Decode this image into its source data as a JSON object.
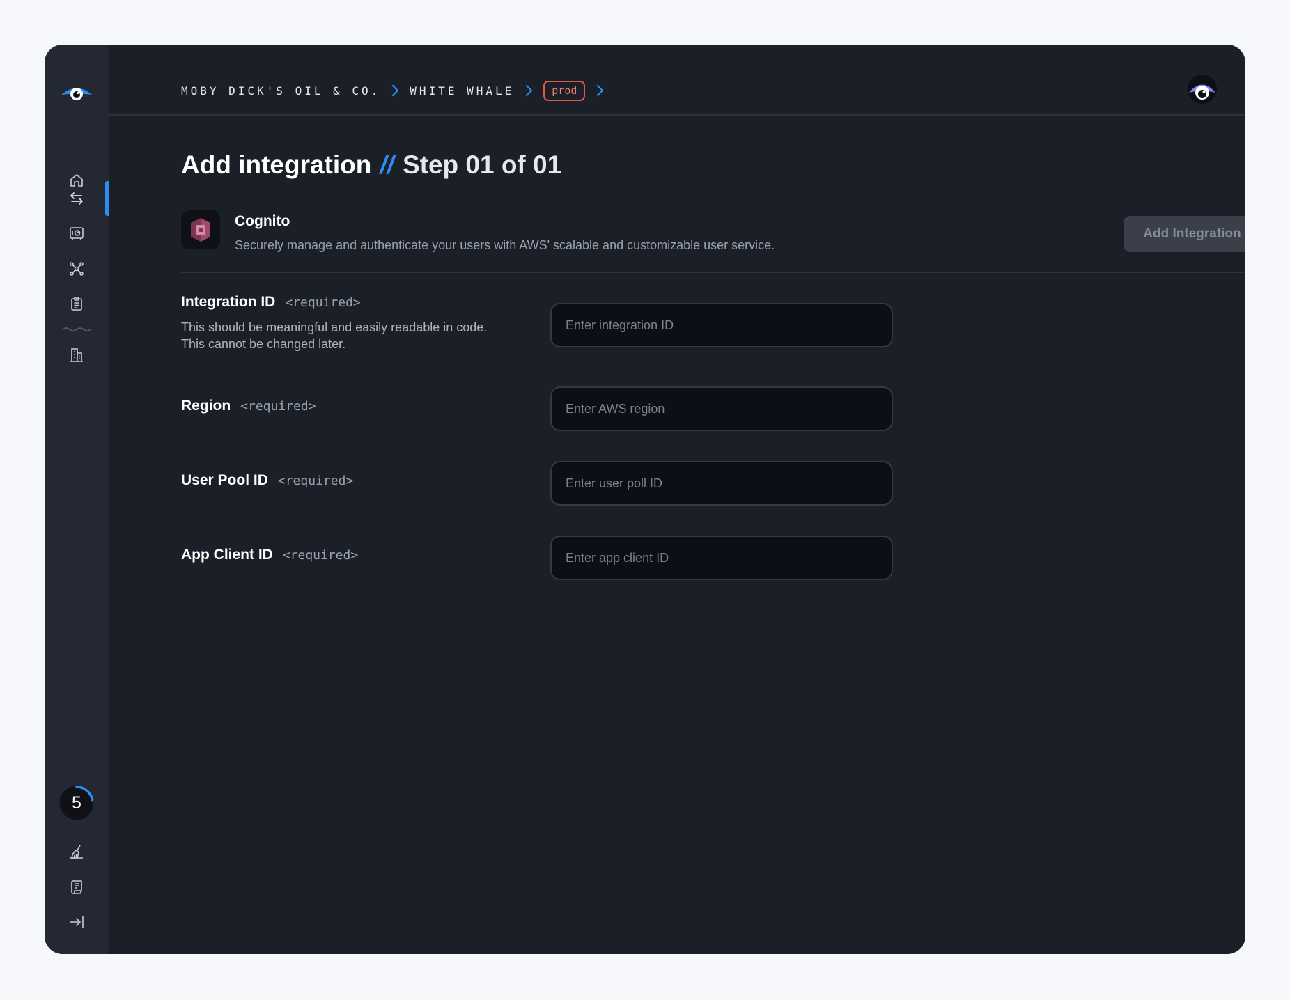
{
  "breadcrumb": {
    "org": "MOBY DICK'S OIL & CO.",
    "project": "WHITE_WHALE",
    "environment": "prod"
  },
  "sidebar": {
    "items": [
      {
        "name": "home",
        "icon": "home-icon"
      },
      {
        "name": "integrations",
        "icon": "swap-arrows-icon",
        "active": true
      },
      {
        "name": "vault",
        "icon": "safe-icon"
      },
      {
        "name": "connections",
        "icon": "network-icon"
      },
      {
        "name": "clipboard",
        "icon": "clipboard-icon"
      },
      {
        "name": "organization",
        "icon": "building-icon"
      }
    ],
    "bottom_items": [
      {
        "name": "clean",
        "icon": "broom-icon"
      },
      {
        "name": "docs",
        "icon": "scroll-icon"
      },
      {
        "name": "collapse",
        "icon": "arrow-to-right-icon"
      }
    ],
    "progress": {
      "value": "5",
      "fraction": 0.22
    }
  },
  "page": {
    "title": "Add integration",
    "separator": "//",
    "step": "Step 01 of 01"
  },
  "integration": {
    "name": "Cognito",
    "description": "Securely manage and authenticate your users with AWS' scalable and customizable user service.",
    "add_button": "Add Integration"
  },
  "fields": {
    "integration_id": {
      "label": "Integration ID",
      "required": "<required>",
      "help_line1": "This should be meaningful and easily readable in code.",
      "help_line2": "This cannot be changed later.",
      "placeholder": "Enter integration ID"
    },
    "region": {
      "label": "Region",
      "required": "<required>",
      "placeholder": "Enter AWS region"
    },
    "user_pool_id": {
      "label": "User Pool ID",
      "required": "<required>",
      "placeholder": "Enter user poll ID"
    },
    "app_client_id": {
      "label": "App Client ID",
      "required": "<required>",
      "placeholder": "Enter app client ID"
    }
  },
  "colors": {
    "accent": "#2d8cf0",
    "badge": "#e0584a",
    "background": "#1b1f27",
    "sidebar": "#232833"
  }
}
